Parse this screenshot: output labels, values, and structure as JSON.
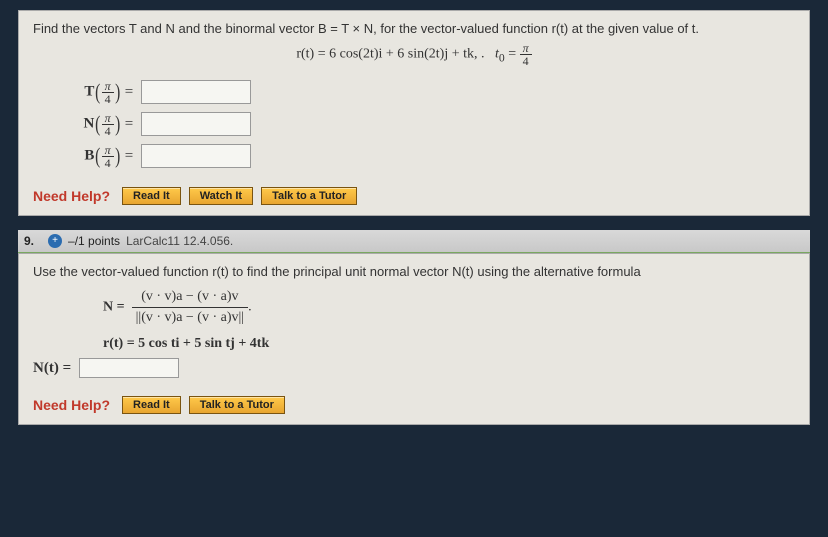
{
  "q_top": {
    "prompt": "Find the vectors T and N and the binormal vector B = T × N, for the vector-valued function r(t) at the given value of t.",
    "equation_r": "r(t) = 6 cos(2t)i + 6 sin(2t)j + tk, .",
    "t0_label": "t",
    "t0_sub": "0",
    "t0_eq": " = ",
    "pi": "π",
    "four": "4",
    "T_label": "T",
    "N_label": "N",
    "B_label": "B",
    "sep_eq": "="
  },
  "q9": {
    "number": "9.",
    "points": "–/1 points",
    "ref": "LarCalc11 12.4.056.",
    "prompt": "Use the vector-valued function r(t) to find the principal unit normal vector N(t) using the alternative formula",
    "N_eq_label": "N =",
    "formula_num": "(v · v)a − (v · a)v",
    "formula_den_inner": "(v · v)a − (v · a)v",
    "rt_eq": "r(t) = 5 cos ti + 5 sin tj + 4tk",
    "Nt_label": "N(t) ="
  },
  "help": {
    "label": "Need Help?",
    "read": "Read It",
    "watch": "Watch It",
    "tutor": "Talk to a Tutor"
  }
}
